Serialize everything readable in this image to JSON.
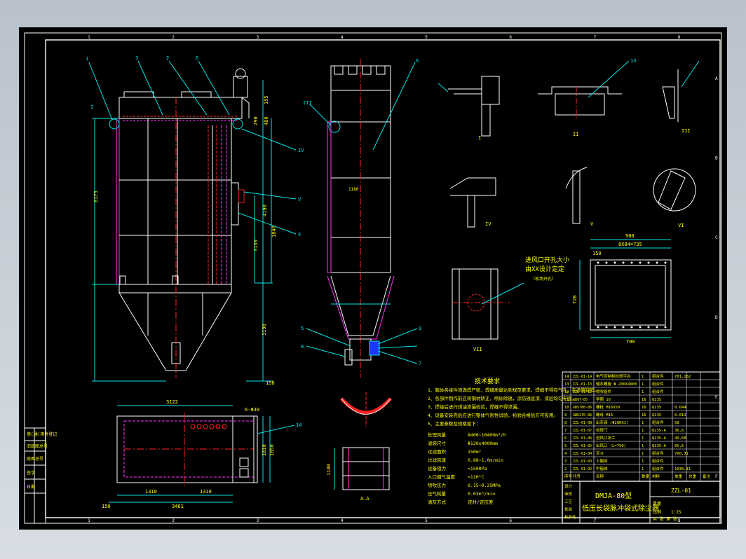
{
  "drawing": {
    "model": "DMJA-80型",
    "title": "低压长袋脉冲袋式除尘器",
    "drawing_no": "ZZL-01",
    "section_label": "A—A",
    "detail_labels": [
      "I",
      "II",
      "III",
      "IV",
      "V",
      "VI",
      "VII"
    ],
    "part_callouts": [
      "1",
      "2",
      "3",
      "4",
      "5",
      "6",
      "7",
      "8",
      "9",
      "13",
      "14"
    ]
  },
  "dimensions": {
    "top_width": "3122",
    "plan_width": "3461",
    "plan_half_left": "1310",
    "plan_half_right": "1310",
    "plan_left_offset": "150",
    "plan_bolt_note": "6-Φ30",
    "plan_depth_a": "1810",
    "plan_depth_b": "1850",
    "hopper_height": "3190",
    "body_height": "6175",
    "inlet_height": "4190",
    "side_height": "3150",
    "bottom_offset": "150",
    "top_h1": "195",
    "top_h2": "480",
    "top_h3": "290",
    "flange_total": "900",
    "flange_pitch": "8X84=735",
    "flange_width": "700",
    "flange_side": "150",
    "flange_height": "720",
    "section_height": "1180",
    "side_mid": "1840",
    "opening_note": [
      "进风口开孔大小",
      "由XX设计定定",
      "（现场开孔）"
    ]
  },
  "tech_requirements": {
    "title": "技术要求",
    "items": [
      "1、箱体各接件须满焊严密，焊缝质量达到规范要求，焊缝不得有气孔、夹渣等缺陷。",
      "2、各部件制作前应将钢材矫正，喷砂除锈，涂防锈底漆，漆层均匀牢固。",
      "3、焊接后进行煤油渗漏检验，焊缝不得渗漏。",
      "4、设备安装完后应进行整体气密性试验，检验合格后方可投用。",
      "5、主要参数及规格如下："
    ],
    "specs": [
      {
        "k": "处理风量",
        "v": "8400~10400m³/h"
      },
      {
        "k": "滤袋尺寸",
        "v": "Φ120x4000mm"
      },
      {
        "k": "过滤面积",
        "v": "150m²"
      },
      {
        "k": "过滤风速",
        "v": "0.88~1.0m/min"
      },
      {
        "k": "设备阻力",
        "v": "<1500Pa"
      },
      {
        "k": "入口烟气温度",
        "v": "<120°C"
      },
      {
        "k": "喷吹压力",
        "v": "0.15~0.25MPa"
      },
      {
        "k": "压气耗量",
        "v": "0.03m³/min"
      },
      {
        "k": "清灰方式",
        "v": "定时/定压差"
      }
    ]
  },
  "parts_list": {
    "rows": [
      {
        "no": "14",
        "code": "ZZL-01-14",
        "name": "电气控制柜检修平台",
        "qty": "1",
        "mat": "组合件",
        "wt": "701,182"
      },
      {
        "no": "13",
        "code": "ZZL-01-13",
        "name": "输灰螺旋 Φ 200X4000",
        "qty": "1",
        "mat": "组合件",
        "wt": ""
      },
      {
        "no": "12",
        "code": "ZZL-01-12",
        "name": "喷吹组件",
        "qty": "1",
        "mat": "组合件",
        "wt": ""
      },
      {
        "no": "11",
        "code": "GB97-85",
        "name": "垫圈 16",
        "qty": "16",
        "mat": "Q235",
        "wt": ""
      },
      {
        "no": "10",
        "code": "GB5780-86",
        "name": "螺栓 M16X50",
        "qty": "16",
        "mat": "Q235",
        "wt": "0.644"
      },
      {
        "no": "9",
        "code": "GB6170-86",
        "name": "螺母 M16",
        "qty": "16",
        "mat": "Q235",
        "wt": "0.012"
      },
      {
        "no": "8",
        "code": "ZZL-01-08",
        "name": "出灰阀 (Φ280X1)",
        "qty": "1",
        "mat": "组合件",
        "wt": "58"
      },
      {
        "no": "7",
        "code": "ZZL-01-07",
        "name": "检修门",
        "qty": "1",
        "mat": "Q235-A",
        "wt": "36,6"
      },
      {
        "no": "6",
        "code": "ZZL-01-06",
        "name": "进风口法兰",
        "qty": "1",
        "mat": "Q235-A",
        "wt": "40,68"
      },
      {
        "no": "5",
        "code": "ZZL-01-05",
        "name": "出风口 (L=750)",
        "qty": "1",
        "mat": "Q235-A",
        "wt": "65,6"
      },
      {
        "no": "4",
        "code": "ZZL-01-04",
        "name": "灰斗",
        "qty": "1",
        "mat": "组合件",
        "wt": "700,31"
      },
      {
        "no": "3",
        "code": "ZZL-01-03",
        "name": "上箱体",
        "qty": "1",
        "mat": "组合件",
        "wt": ""
      },
      {
        "no": "2",
        "code": "ZZL-01-02",
        "name": "中箱体",
        "qty": "1",
        "mat": "组合件",
        "wt": "1030,11"
      }
    ],
    "header": [
      "序号",
      "代号",
      "名称",
      "数量",
      "材料",
      "单重",
      "总重",
      "备注"
    ]
  },
  "title_block": {
    "labels": [
      "设计",
      "审核",
      "工艺",
      "批准",
      "标准化"
    ],
    "scale_label": "比例",
    "scale": "1:25",
    "sheet": "共 张 第 张",
    "weight_label": "重量"
  },
  "revision_block": {
    "labels": [
      "借(通)用件登记",
      "旧底图总号",
      "底图总号",
      "签字",
      "日期"
    ]
  },
  "border": {
    "top_zones": [
      "1",
      "2",
      "3",
      "4",
      "5",
      "6",
      "7",
      "8"
    ],
    "side_zones": [
      "A",
      "B",
      "C",
      "D",
      "E",
      "F"
    ]
  },
  "colors": {
    "line": "#ffffff",
    "dimension": "#00e5e5",
    "leader": "#00e5e5",
    "text": "#ffff00",
    "hidden": "#ff33ff",
    "center": "#ff2020",
    "frame": "#ffffff"
  }
}
